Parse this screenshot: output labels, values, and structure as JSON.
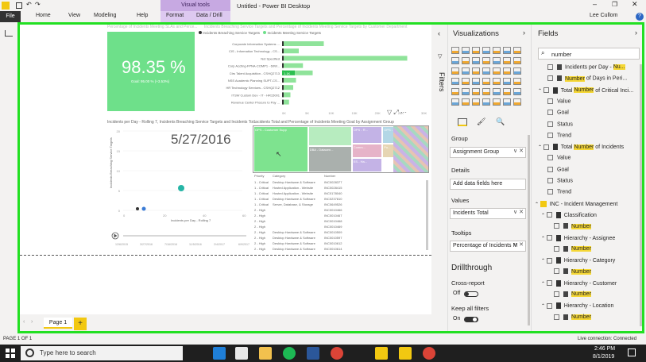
{
  "window": {
    "title": "Untitled - Power BI Desktop",
    "user": "Lee Cullom"
  },
  "ribbon": {
    "context_tab": "Visual tools",
    "tabs": [
      "File",
      "Home",
      "View",
      "Modeling",
      "Help",
      "Format",
      "Data / Drill"
    ]
  },
  "canvas": {
    "card_title": "Percentage of Incidents Meeting SLAs and Perce...",
    "card_value": "98.35 %",
    "card_goal": "Goal: 95.00 % (+3.53%)",
    "bar_title": "Incidents Breaching Service Targets and Percentage of Incidents Meeting Service Targets by Customer Department",
    "bar_legend": [
      "Incidents Breaching Service Targets",
      "Incidents Meeting Service Targets"
    ],
    "bar_categories": [
      "Corporate Information Systems ...",
      "CIS - Information Technology - CS...",
      "Not Specified",
      "Corp Accting-FPNA-COMP1 - 60W...",
      "Ctrs Talent Acquisition - CSHQ2713",
      "NSS Academic Planning SUPT-CS...",
      "HR Technology Services - CSHQ2712",
      "ITSW Custom Dev - IT - HR15001",
      "Revenue Center Procure to Pay ..."
    ],
    "bar_values": [
      0.3,
      0.12,
      0.9,
      0.15,
      0.22,
      0.1,
      0.08,
      0.06,
      0.05
    ],
    "bar_label": "1.1K",
    "bar_ticks": [
      "0K",
      "5K",
      "10K",
      "15K",
      "20K",
      "25K",
      "30K"
    ],
    "scatter_title": "Incidents per Day - Rolling 7, Incidents Breaching Service Targets and Incidents Tot...",
    "scatter_date": "5/27/2016",
    "scatter_xlabel": "Incidents per Day - Rolling 7",
    "scatter_ylabel": "Incidents Breaching Service Targets",
    "scatter_yticks": [
      "20",
      "15",
      "10",
      "5",
      "0"
    ],
    "scatter_xticks": [
      "0",
      "20",
      "40",
      "60"
    ],
    "play_ticks": [
      "12/6/2015",
      "3/27/2016",
      "7/16/2016",
      "11/5/2016",
      "2/4/2017",
      "6/9/2017"
    ],
    "treemap_title": "Incidents Total and Percentage of Incidents Meeting Goal by Assignment Group",
    "treemap_tiles": [
      "OPS - Customer Supp",
      "",
      "DBA - Datacen...",
      "OPS - R...",
      "Comm...",
      "OPS - Ne...",
      "Pu...",
      "ES - Ha...",
      "ISD - ERP - Syst...",
      "OPS - DL...",
      "OPS - A..."
    ],
    "table_headers": [
      "Priority",
      "Category",
      "Number"
    ],
    "table_rows": [
      [
        "1 - Critical",
        "Desktop Hardware & Software",
        "INC0028377"
      ],
      [
        "1 - Critical",
        "Hosted Application - Website",
        "INC0028415"
      ],
      [
        "1 - Critical",
        "Hosted Application - Website",
        "INC0178040"
      ],
      [
        "1 - Critical",
        "Desktop Hardware & Software",
        "INC0237810"
      ],
      [
        "1 - Critical",
        "Server, Database, & Storage",
        "INC0649526"
      ],
      [
        "2 - High",
        "",
        "INC0010466"
      ],
      [
        "2 - High",
        "",
        "INC0010467"
      ],
      [
        "2 - High",
        "",
        "INC0010468"
      ],
      [
        "2 - High",
        "",
        "INC0010469"
      ],
      [
        "2 - High",
        "Desktop Hardware & Software",
        "INC0010509"
      ],
      [
        "2 - High",
        "Desktop Hardware & Software",
        "INC0010597"
      ],
      [
        "2 - High",
        "Desktop Hardware & Software",
        "INC0010612"
      ],
      [
        "2 - High",
        "Desktop Hardware & Software",
        "INC0010614"
      ]
    ]
  },
  "page_tab": "Page 1",
  "page_add": "+",
  "status_left": "PAGE 1 OF 1",
  "status_right": "Live connection: Connected",
  "filters_label": "Filters",
  "visualizations": {
    "header": "Visualizations",
    "group_label": "Group",
    "group_value": "Assignment Group",
    "details_label": "Details",
    "details_placeholder": "Add data fields here",
    "values_label": "Values",
    "values_value": "Incidents Total",
    "tooltips_label": "Tooltips",
    "tooltips_value": "Percentage of Incidents M",
    "drillthrough": "Drillthrough",
    "cross_report": "Cross-report",
    "cross_state": "Off",
    "keep_filters": "Keep all filters",
    "keep_state": "On"
  },
  "fields": {
    "header": "Fields",
    "search_value": "number",
    "items": [
      {
        "pre": "Incidents per Day - ",
        "hl": "Nu...",
        "post": ""
      },
      {
        "pre": "",
        "hl": "Number",
        "post": " of Days in Peri..."
      },
      {
        "pre": "Total ",
        "hl": "Number",
        "post": " of Critical Inci..."
      },
      {
        "pre": "Value",
        "hl": "",
        "post": ""
      },
      {
        "pre": "Goal",
        "hl": "",
        "post": ""
      },
      {
        "pre": "Status",
        "hl": "",
        "post": ""
      },
      {
        "pre": "Trend",
        "hl": "",
        "post": ""
      },
      {
        "pre": "Total ",
        "hl": "Number",
        "post": " of Incidents"
      },
      {
        "pre": "Value",
        "hl": "",
        "post": ""
      },
      {
        "pre": "Goal",
        "hl": "",
        "post": ""
      },
      {
        "pre": "Status",
        "hl": "",
        "post": ""
      },
      {
        "pre": "Trend",
        "hl": "",
        "post": ""
      },
      {
        "pre": "INC - Incident Management",
        "hl": "",
        "post": ""
      },
      {
        "pre": "Classification",
        "hl": "",
        "post": ""
      },
      {
        "pre": "",
        "hl": "Number",
        "post": ""
      },
      {
        "pre": "Hierarchy - Assignee",
        "hl": "",
        "post": ""
      },
      {
        "pre": "",
        "hl": "Number",
        "post": ""
      },
      {
        "pre": "Hierarchy - Category",
        "hl": "",
        "post": ""
      },
      {
        "pre": "",
        "hl": "Number",
        "post": ""
      },
      {
        "pre": "Hierarchy - Customer",
        "hl": "",
        "post": ""
      },
      {
        "pre": "",
        "hl": "Number",
        "post": ""
      },
      {
        "pre": "Hierarchy - Location",
        "hl": "",
        "post": ""
      },
      {
        "pre": "",
        "hl": "Number",
        "post": ""
      }
    ]
  },
  "taskbar": {
    "search_placeholder": "Type here to search",
    "time": "2:46 PM",
    "date": "8/1/2019"
  },
  "colors": {
    "accent_green": "#22e022",
    "card_green": "#6ee08a",
    "highlight": "#f5d735",
    "teal": "#26b5a6"
  }
}
